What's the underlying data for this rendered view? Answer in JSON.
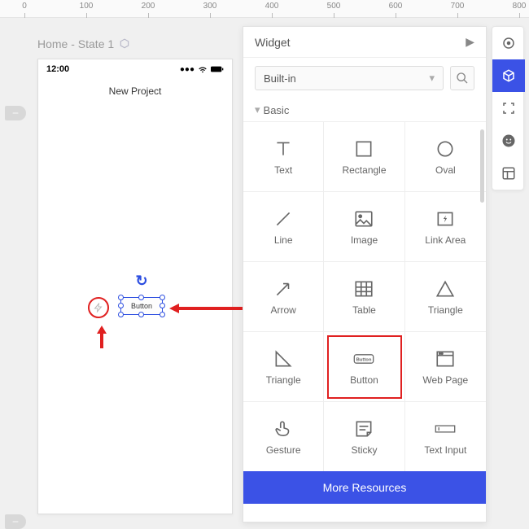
{
  "ruler": {
    "major": [
      0,
      100,
      200,
      300,
      400,
      500,
      600,
      700,
      800
    ]
  },
  "breadcrumb": {
    "label": "Home - State 1"
  },
  "phone": {
    "time": "12:00",
    "title": "New Project"
  },
  "canvas_widget": {
    "button_label": "Button"
  },
  "panel": {
    "title": "Widget",
    "dropdown_value": "Built-in",
    "group_label": "Basic",
    "items": [
      {
        "label": "Text"
      },
      {
        "label": "Rectangle"
      },
      {
        "label": "Oval"
      },
      {
        "label": "Line"
      },
      {
        "label": "Image"
      },
      {
        "label": "Link Area"
      },
      {
        "label": "Arrow"
      },
      {
        "label": "Table"
      },
      {
        "label": "Triangle"
      },
      {
        "label": "Triangle"
      },
      {
        "label": "Button"
      },
      {
        "label": "Web Page"
      },
      {
        "label": "Gesture"
      },
      {
        "label": "Sticky"
      },
      {
        "label": "Text Input"
      }
    ],
    "more_label": "More Resources"
  }
}
